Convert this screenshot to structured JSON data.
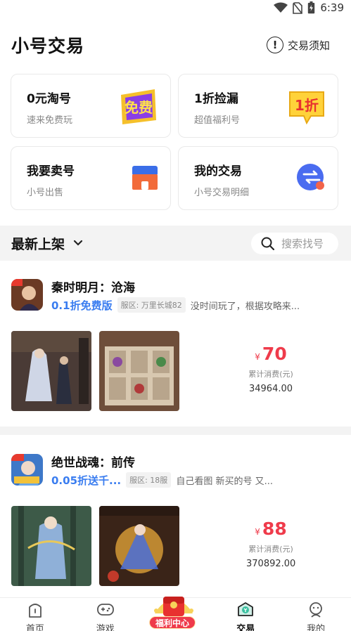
{
  "status": {
    "time": "6:39"
  },
  "header": {
    "title": "小号交易",
    "notice_label": "交易须知"
  },
  "cards": [
    {
      "title": "0元淘号",
      "subtitle": "速来免费玩",
      "badge": "免费"
    },
    {
      "title": "1折捡漏",
      "subtitle": "超值福利号",
      "badge": "1折"
    },
    {
      "title": "我要卖号",
      "subtitle": "小号出售"
    },
    {
      "title": "我的交易",
      "subtitle": "小号交易明细"
    }
  ],
  "filter": {
    "sort_label": "最新上架",
    "search_placeholder": "搜索找号"
  },
  "listings": [
    {
      "game": "秦时明月：沧海",
      "discount": "0.1折免费版",
      "server": "服区: 万里长城82",
      "desc": "没时间玩了，根据攻略来...",
      "currency": "¥",
      "price": "70",
      "spent_label": "累计消费(元)",
      "spent": "34964.00"
    },
    {
      "game": "绝世战魂：前传",
      "discount": "0.05折送千...",
      "server": "服区: 18服",
      "desc": "自己看图  新买的号  又...",
      "currency": "¥",
      "price": "88",
      "spent_label": "累计消费(元)",
      "spent": "370892.00"
    }
  ],
  "tabbar": {
    "home": "首页",
    "games": "游戏",
    "welfare": "福利中心",
    "trade": "交易",
    "mine": "我的"
  },
  "colors": {
    "accent": "#3a7df0",
    "price": "#ef3b4b"
  }
}
